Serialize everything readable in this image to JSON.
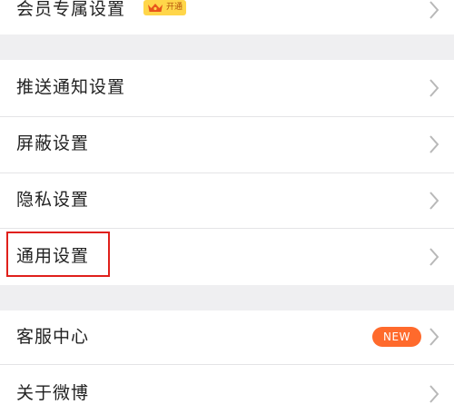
{
  "settings": {
    "vip_settings": {
      "label": "会员专属设置",
      "badge_text": "开通"
    },
    "push_settings": {
      "label": "推送通知设置"
    },
    "block_settings": {
      "label": "屏蔽设置"
    },
    "privacy_settings": {
      "label": "隐私设置"
    },
    "general_settings": {
      "label": "通用设置",
      "highlighted": true
    },
    "customer_service": {
      "label": "客服中心",
      "badge_text": "NEW"
    },
    "about": {
      "label": "关于微博"
    }
  },
  "colors": {
    "background": "#efeff1",
    "row": "#ffffff",
    "text": "#222222",
    "chevron": "#b8b8b8",
    "vip_badge": "#ffd64a",
    "new_badge": "#ff6a2c",
    "highlight_border": "#e0201b"
  },
  "icons": {
    "chevron": "chevron-right-icon",
    "vip": "crown-icon"
  }
}
